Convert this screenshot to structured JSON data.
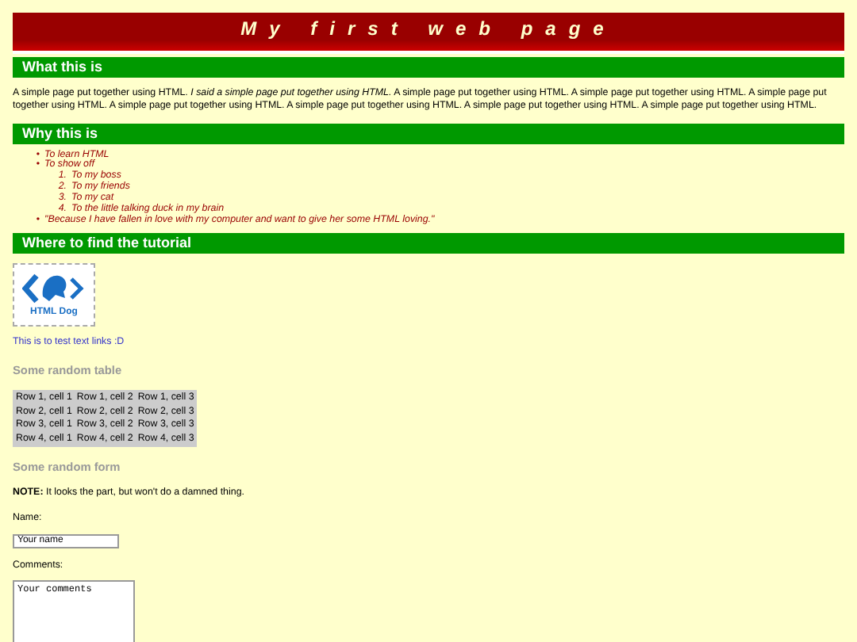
{
  "title": "My first web page",
  "sections": [
    {
      "heading": "What this is",
      "paragraph": "A simple page put together using HTML. *I said a simple page put together using HTML.* A simple page put together using HTML. A simple page put together using HTML. A simple page put together using HTML. A simple page put together using HTML. A simple page put together using HTML. A simple page put together using HTML. A simple page put together using HTML."
    },
    {
      "heading": "Why this is",
      "list": [
        {
          "marker": "•",
          "text": "To learn HTML"
        },
        {
          "marker": "•",
          "text": "To show off",
          "children": [
            {
              "marker": "1.",
              "text": "To my boss"
            },
            {
              "marker": "2.",
              "text": "To my friends"
            },
            {
              "marker": "3.",
              "text": "To my cat"
            },
            {
              "marker": "4.",
              "text": "To the little talking duck in my brain"
            }
          ]
        },
        {
          "marker": "•",
          "text": "\"Because I have fallen in love with my computer and want to give her some HTML loving.\""
        }
      ]
    },
    {
      "heading": "Where to find the tutorial",
      "logo": {
        "text": "HTML Dog"
      },
      "link": "This is to test text links :D"
    }
  ],
  "table": {
    "heading": "Some random table",
    "rows": [
      [
        "Row 1, cell 1",
        "Row 1, cell 2",
        "Row 1, cell 3"
      ],
      [
        "Row 2, cell 1",
        "Row 2, cell 2",
        "Row 2, cell 3"
      ],
      [
        "Row 3, cell 1",
        "Row 3, cell 2",
        "Row 3, cell 3"
      ],
      [
        "Row 4, cell 1",
        "Row 4, cell 2",
        "Row 4, cell 3"
      ]
    ]
  },
  "form": {
    "heading": "Some random form",
    "note": "**NOTE:** It looks the part, but won't do a damned thing.",
    "name_label": "Name:",
    "name_value": "Your name",
    "comments_label": "Comments:",
    "comments_value": "Your comments"
  }
}
